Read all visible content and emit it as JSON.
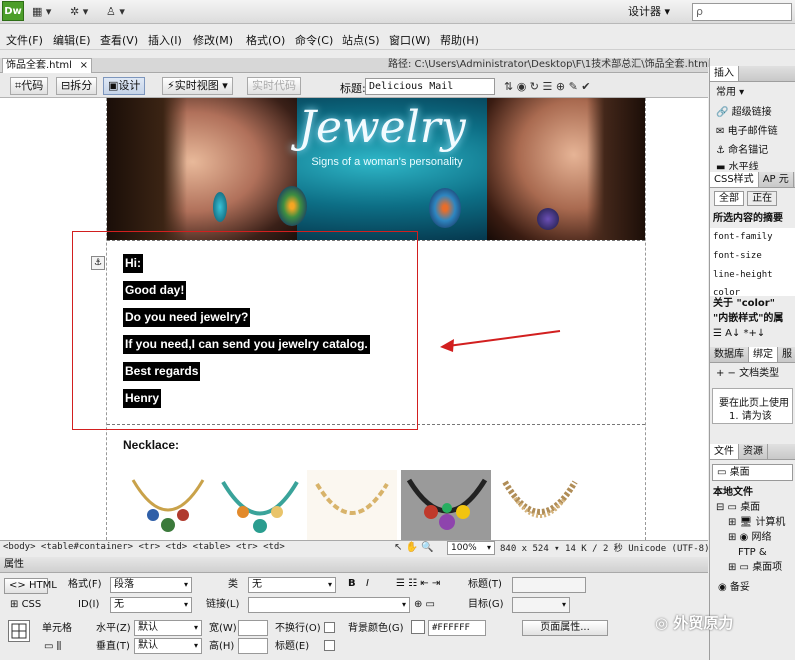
{
  "app": {
    "logo": "Dw",
    "workspace": "设计器 ▾",
    "search_placeholder": "ρ"
  },
  "menu": [
    "文件(F)",
    "编辑(E)",
    "查看(V)",
    "插入(I)",
    "修改(M)",
    "格式(O)",
    "命令(C)",
    "站点(S)",
    "窗口(W)",
    "帮助(H)"
  ],
  "document": {
    "tab_label": "饰品全套.html",
    "path": "路径:  C:\\Users\\Administrator\\Desktop\\F\\1技术部总汇\\饰品全套.html",
    "toolbar": {
      "code": "代码",
      "split": "拆分",
      "design": "设计",
      "live_view": "实时视图",
      "live_code": "实时代码",
      "title_label": "标题:",
      "title_value": "Delicious Mail"
    }
  },
  "banner": {
    "title": "Jewelry",
    "subtitle": "Signs of a woman's personality"
  },
  "email_lines": [
    "Hi:",
    "Good day!",
    "Do you need jewelry?",
    "If you need,I can send you jewelry catalog.",
    "Best regards",
    "Henry"
  ],
  "section_label": "Necklace:",
  "status": {
    "tags": "<body> <table#container> <tr> <td> <table> <tr> <td>",
    "zoom": "100%",
    "info": "840 x 524 ▾  14 K / 2 秒  Unicode (UTF-8)"
  },
  "properties": {
    "header": "属性",
    "html": "HTML",
    "css": "CSS",
    "format_label": "格式(F)",
    "format_value": "段落",
    "class_label": "类",
    "class_value": "无",
    "id_label": "ID(I)",
    "id_value": "无",
    "link_label": "链接(L)",
    "title_label": "标题(T)",
    "target_label": "目标(G)",
    "cell_label": "单元格",
    "horz_label": "水平(Z)",
    "horz_value": "默认",
    "vert_label": "垂直(T)",
    "vert_value": "默认",
    "width_label": "宽(W)",
    "height_label": "高(H)",
    "nowrap_label": "不换行(O)",
    "header_cb_label": "标题(E)",
    "bg_label": "背景颜色(G)",
    "bg_value": "#FFFFFF",
    "page_props": "页面属性..."
  },
  "right_panel": {
    "insert_tab": "插入",
    "common": "常用 ▾",
    "insert_items": [
      "超级链接",
      "电子邮件链",
      "命名锚记",
      "水平线"
    ],
    "css_tabs": [
      "CSS样式",
      "AP 元"
    ],
    "css_mode": [
      "全部",
      "正在"
    ],
    "summary_label": "所选内容的摘要",
    "props": [
      "font-family",
      "font-size",
      "line-height",
      "color"
    ],
    "about": "关于 \"color\"",
    "inline": "\"内嵌样式\"的属",
    "db_tabs": [
      "数据库",
      "绑定",
      "服"
    ],
    "doc_type": "文档类型",
    "use_text": "要在此页上使用",
    "step": "1. 请为该",
    "files_tabs": [
      "文件",
      "资源"
    ],
    "site_select": "桌面",
    "local_files": "本地文件",
    "tree": [
      "桌面",
      "计算机",
      "网络",
      "FTP &",
      "桌面项"
    ],
    "backup": "备妥"
  },
  "watermark": "外贸原力",
  "colors": {
    "annotation": "#d21f1f",
    "highlight_bg": "#000000",
    "highlight_fg": "#ffffff"
  }
}
